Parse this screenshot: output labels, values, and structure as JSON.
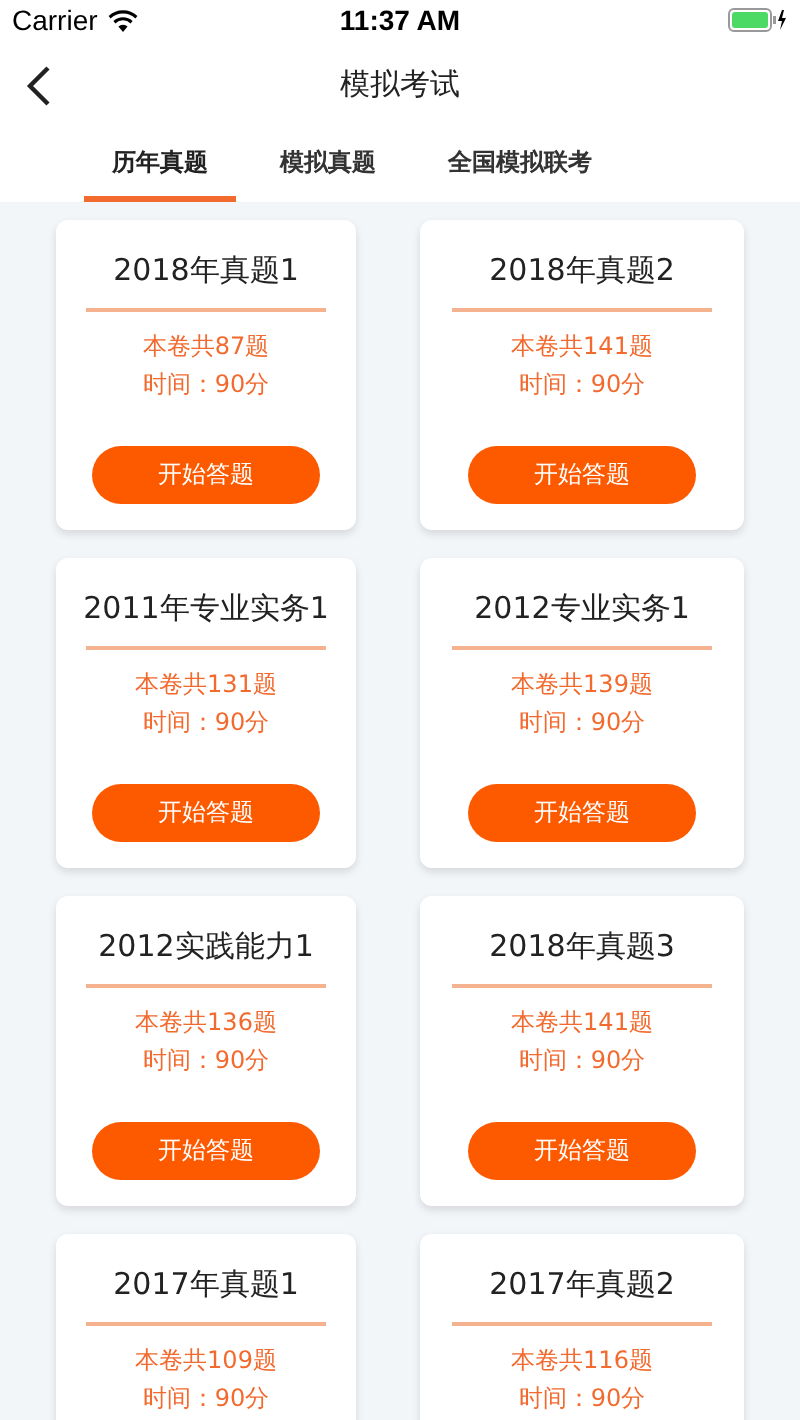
{
  "status_bar": {
    "carrier": "Carrier",
    "time": "11:37 AM"
  },
  "nav": {
    "title": "模拟考试"
  },
  "tabs": [
    {
      "label": "历年真题",
      "selected": true
    },
    {
      "label": "模拟真题",
      "selected": false
    },
    {
      "label": "全国模拟联考",
      "selected": false
    }
  ],
  "papers": [
    {
      "title": "2018年真题1",
      "count": "本卷共87题",
      "time": "时间：90分",
      "button": "开始答题"
    },
    {
      "title": "2018年真题2",
      "count": "本卷共141题",
      "time": "时间：90分",
      "button": "开始答题"
    },
    {
      "title": "2011年专业实务1",
      "count": "本卷共131题",
      "time": "时间：90分",
      "button": "开始答题"
    },
    {
      "title": "2012专业实务1",
      "count": "本卷共139题",
      "time": "时间：90分",
      "button": "开始答题"
    },
    {
      "title": "2012实践能力1",
      "count": "本卷共136题",
      "time": "时间：90分",
      "button": "开始答题"
    },
    {
      "title": "2018年真题3",
      "count": "本卷共141题",
      "time": "时间：90分",
      "button": "开始答题"
    },
    {
      "title": "2017年真题1",
      "count": "本卷共109题",
      "time": "时间：90分"
    },
    {
      "title": "2017年真题2",
      "count": "本卷共116题",
      "time": "时间：90分"
    }
  ]
}
